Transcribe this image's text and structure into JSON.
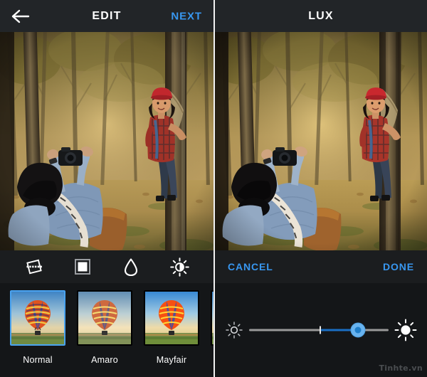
{
  "left_panel": {
    "header": {
      "back_icon": "back-arrow-icon",
      "title": "EDIT",
      "next_label": "NEXT",
      "next_color": "#3897f0"
    },
    "photo": {
      "alt": "photographer kneeling in rubber tree forest photographing woman in red beanie and plaid shirt leaning on tree"
    },
    "tools": [
      {
        "name": "adjust-tool",
        "icon": "rotate-straighten-icon"
      },
      {
        "name": "border-tool",
        "icon": "frame-square-icon"
      },
      {
        "name": "tiltshift-tool",
        "icon": "water-drop-icon"
      },
      {
        "name": "lux-tool",
        "icon": "sun-half-icon"
      }
    ],
    "filters": [
      {
        "label": "Normal",
        "selected": true
      },
      {
        "label": "Amaro",
        "selected": false
      },
      {
        "label": "Mayfair",
        "selected": false
      },
      {
        "label": "",
        "selected": false
      }
    ],
    "filter_thumb_alt": "hot air balloon over field at dawn"
  },
  "right_panel": {
    "header": {
      "title": "LUX"
    },
    "photo": {
      "alt": "same forest photo with lux adjustment applied"
    },
    "actions": {
      "cancel_label": "CANCEL",
      "done_label": "DONE",
      "action_color": "#3897f0"
    },
    "slider": {
      "left_icon": "sun-dim-icon",
      "right_icon": "sun-bright-icon",
      "value_percent": 78,
      "tick_percent": 51,
      "track_color": "#9a9a9a",
      "fill_color": "#1a6fc4",
      "thumb_color": "#68b3ef"
    }
  },
  "watermark": {
    "text": "Tinhte.vn"
  }
}
